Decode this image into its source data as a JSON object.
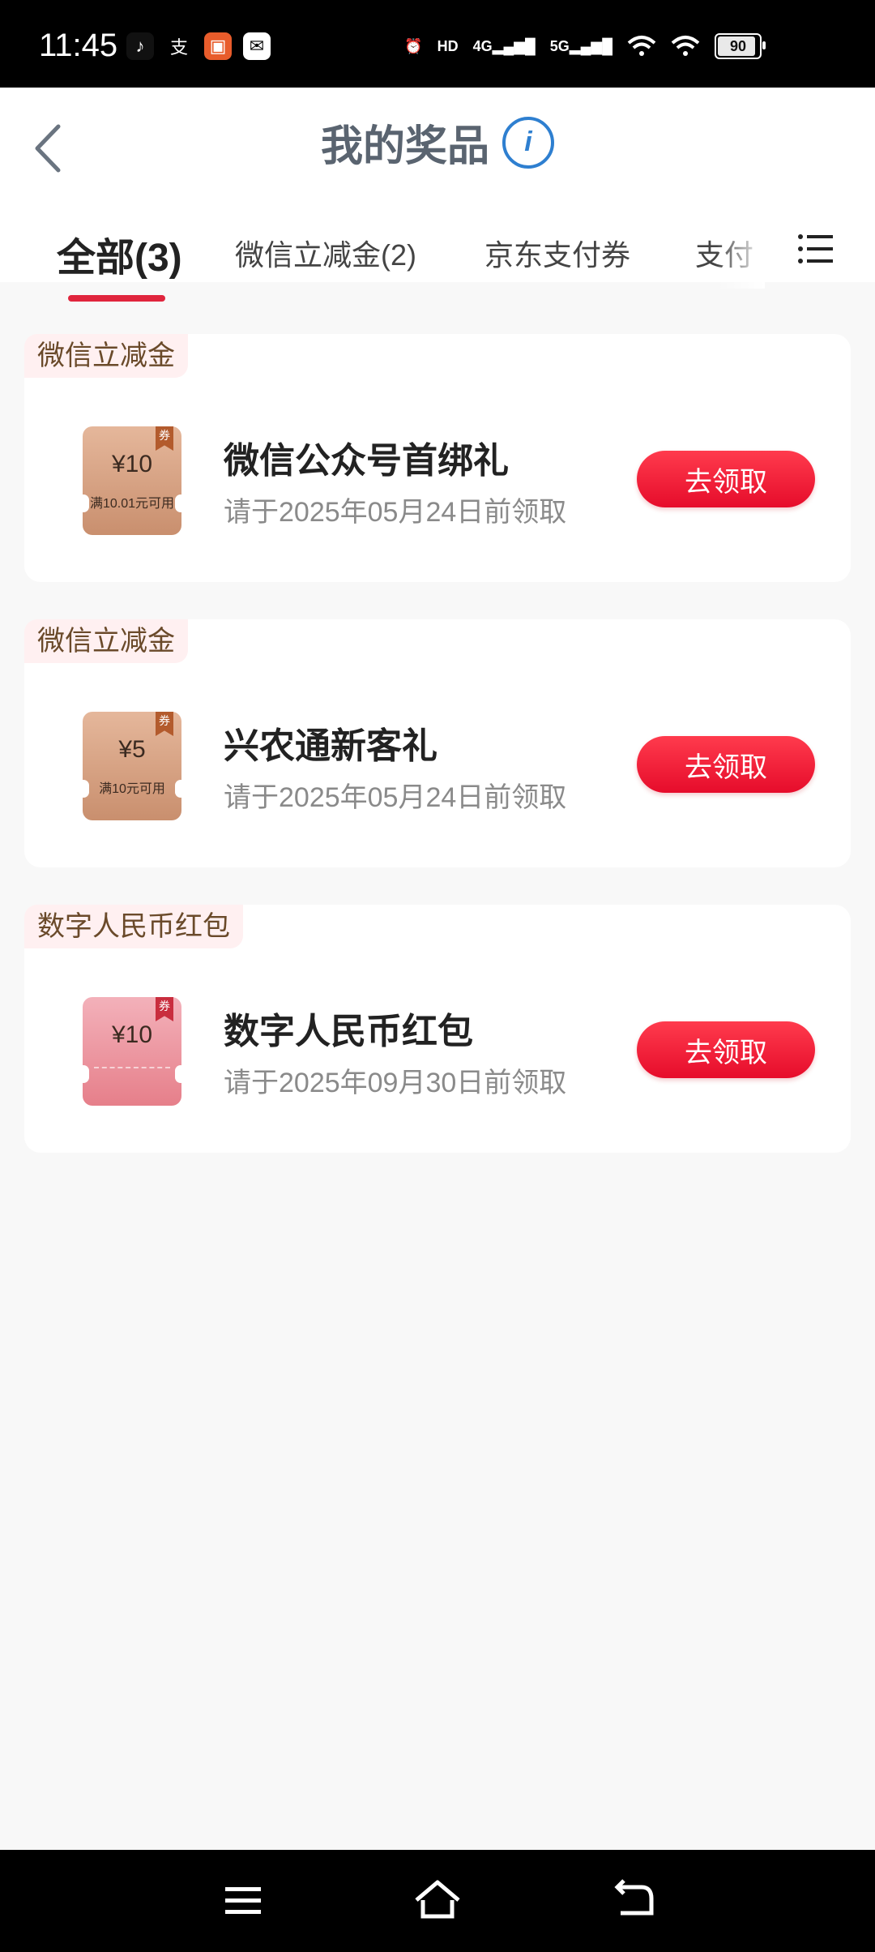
{
  "status_bar": {
    "time": "11:45",
    "icons": [
      "tiktok-icon",
      "alipay-icon",
      "app-icon",
      "mail-icon",
      "alarm-icon",
      "hd-icon",
      "4g-signal-icon",
      "5g-signal-icon",
      "wifi-icon",
      "wifi-icon"
    ],
    "battery": "90"
  },
  "header": {
    "title": "我的奖品"
  },
  "tabs": [
    {
      "label": "全部(3)"
    },
    {
      "label": "微信立减金(2)"
    },
    {
      "label": "京东支付券"
    },
    {
      "label": "支付"
    }
  ],
  "cards": [
    {
      "tag": "微信立减金",
      "ticket": {
        "amount": "¥10",
        "condition": "满10.01元可用",
        "badge": "券"
      },
      "title": "微信公众号首绑礼",
      "subtitle": "请于2025年05月24日前领取",
      "button": "去领取"
    },
    {
      "tag": "微信立减金",
      "ticket": {
        "amount": "¥5",
        "condition": "满10元可用",
        "badge": "券"
      },
      "title": "兴农通新客礼",
      "subtitle": "请于2025年05月24日前领取",
      "button": "去领取"
    },
    {
      "tag": "数字人民币红包",
      "ticket": {
        "amount": "¥10",
        "condition": "",
        "badge": "券"
      },
      "title": "数字人民币红包",
      "subtitle": "请于2025年09月30日前领取",
      "button": "去领取"
    }
  ],
  "colors": {
    "accent": "#e0253d",
    "button": "#f20f2d",
    "tag_bg": "#fff0f1",
    "tag_text": "#6a4a2a"
  }
}
